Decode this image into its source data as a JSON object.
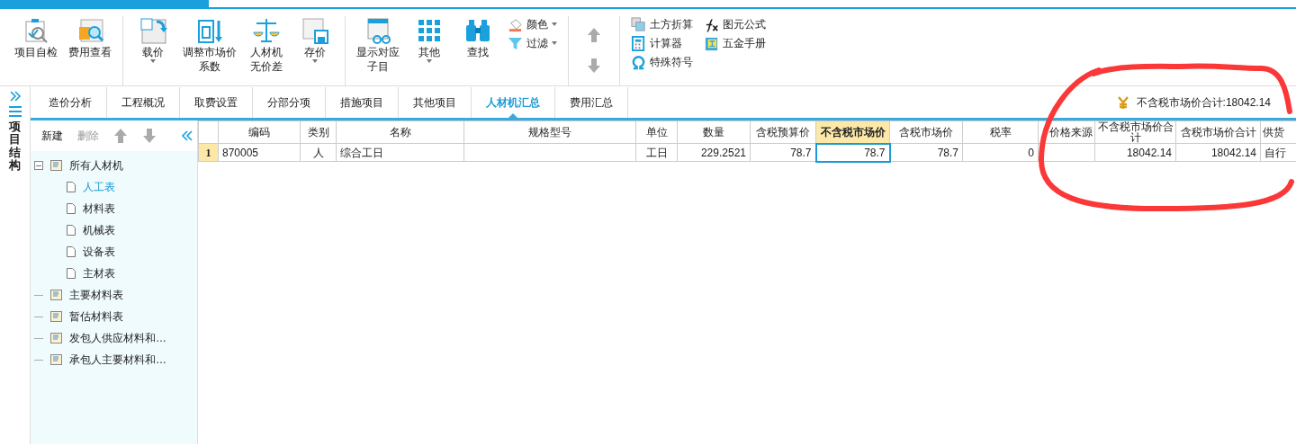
{
  "ribbon": {
    "groups": [
      {
        "items": [
          {
            "kind": "large",
            "label": "项目自检",
            "dropdown": false
          },
          {
            "kind": "large",
            "label": "费用查看",
            "dropdown": false
          }
        ]
      },
      {
        "items": [
          {
            "kind": "large",
            "label": "载价",
            "dropdown": true
          },
          {
            "kind": "large",
            "lines": [
              "调整市场价",
              "系数"
            ],
            "dropdown": false
          },
          {
            "kind": "large",
            "lines": [
              "人材机",
              "无价差"
            ],
            "dropdown": false
          },
          {
            "kind": "large",
            "label": "存价",
            "dropdown": true
          }
        ]
      },
      {
        "items": [
          {
            "kind": "large",
            "lines": [
              "显示对应",
              "子目"
            ],
            "dropdown": false
          },
          {
            "kind": "large",
            "label": "其他",
            "dropdown": true
          },
          {
            "kind": "large",
            "label": "查找",
            "dropdown": false
          },
          {
            "kind": "small",
            "label": "颜色",
            "dropdown": true
          },
          {
            "kind": "small",
            "label": "过滤",
            "dropdown": true
          }
        ]
      },
      {
        "items": [
          {
            "kind": "arrow",
            "disabled": true
          },
          {
            "kind": "arrow",
            "disabled": true
          }
        ]
      },
      {
        "items": [
          {
            "kind": "small",
            "label": "土方折算",
            "dropdown": false
          },
          {
            "kind": "small",
            "label": "计算器",
            "dropdown": false
          },
          {
            "kind": "small",
            "label": "特殊符号",
            "dropdown": false
          },
          {
            "kind": "small",
            "label": "图元公式",
            "dropdown": false
          },
          {
            "kind": "small",
            "label": "五金手册",
            "dropdown": false
          }
        ]
      }
    ]
  },
  "side_strip": {
    "title": "项目结构"
  },
  "tabs": [
    {
      "label": "造价分析",
      "selected": false
    },
    {
      "label": "工程概况",
      "selected": false
    },
    {
      "label": "取费设置",
      "selected": false
    },
    {
      "label": "分部分项",
      "selected": false
    },
    {
      "label": "措施项目",
      "selected": false
    },
    {
      "label": "其他项目",
      "selected": false
    },
    {
      "label": "人材机汇总",
      "selected": true
    },
    {
      "label": "费用汇总",
      "selected": false
    }
  ],
  "summary": "不含税市场价合计:18042.14",
  "tree_toolbar": [
    {
      "label": "新建",
      "disabled": false
    },
    {
      "label": "删除",
      "disabled": true
    },
    {
      "kind": "up",
      "disabled": true
    },
    {
      "kind": "down",
      "disabled": true
    }
  ],
  "tree": [
    {
      "label": "所有人材机",
      "expanded": true,
      "selected": false,
      "children": [
        {
          "label": "人工表",
          "selected": true
        },
        {
          "label": "材料表",
          "selected": false
        },
        {
          "label": "机械表",
          "selected": false
        },
        {
          "label": "设备表",
          "selected": false
        },
        {
          "label": "主材表",
          "selected": false
        }
      ]
    },
    {
      "label": "主要材料表",
      "selected": false
    },
    {
      "label": "暂估材料表",
      "selected": false
    },
    {
      "label": "发包人供应材料和…",
      "selected": false
    },
    {
      "label": "承包人主要材料和…",
      "selected": false
    }
  ],
  "table": {
    "columns": [
      {
        "label": "编码",
        "selected": false
      },
      {
        "label": "类别",
        "selected": false
      },
      {
        "label": "名称",
        "selected": false
      },
      {
        "label": "规格型号",
        "selected": false
      },
      {
        "label": "单位",
        "selected": false
      },
      {
        "label": "数量",
        "selected": false
      },
      {
        "label": "含税预算价",
        "selected": false
      },
      {
        "label": "不含税市场价",
        "selected": true
      },
      {
        "label": "含税市场价",
        "selected": false
      },
      {
        "label": "税率",
        "selected": false
      },
      {
        "label": "价格来源",
        "selected": false
      },
      {
        "label": "不含税市场价合计",
        "selected": false
      },
      {
        "label": "含税市场价合计",
        "selected": false
      },
      {
        "label": "供货",
        "selected": false
      }
    ],
    "rows": [
      {
        "number": "1",
        "cells": [
          "870005",
          "人",
          "综合工日",
          "",
          "工日",
          "229.2521",
          "78.7",
          "78.7",
          "78.7",
          "0",
          "",
          "18042.14",
          "18042.14",
          "自行"
        ]
      }
    ]
  }
}
